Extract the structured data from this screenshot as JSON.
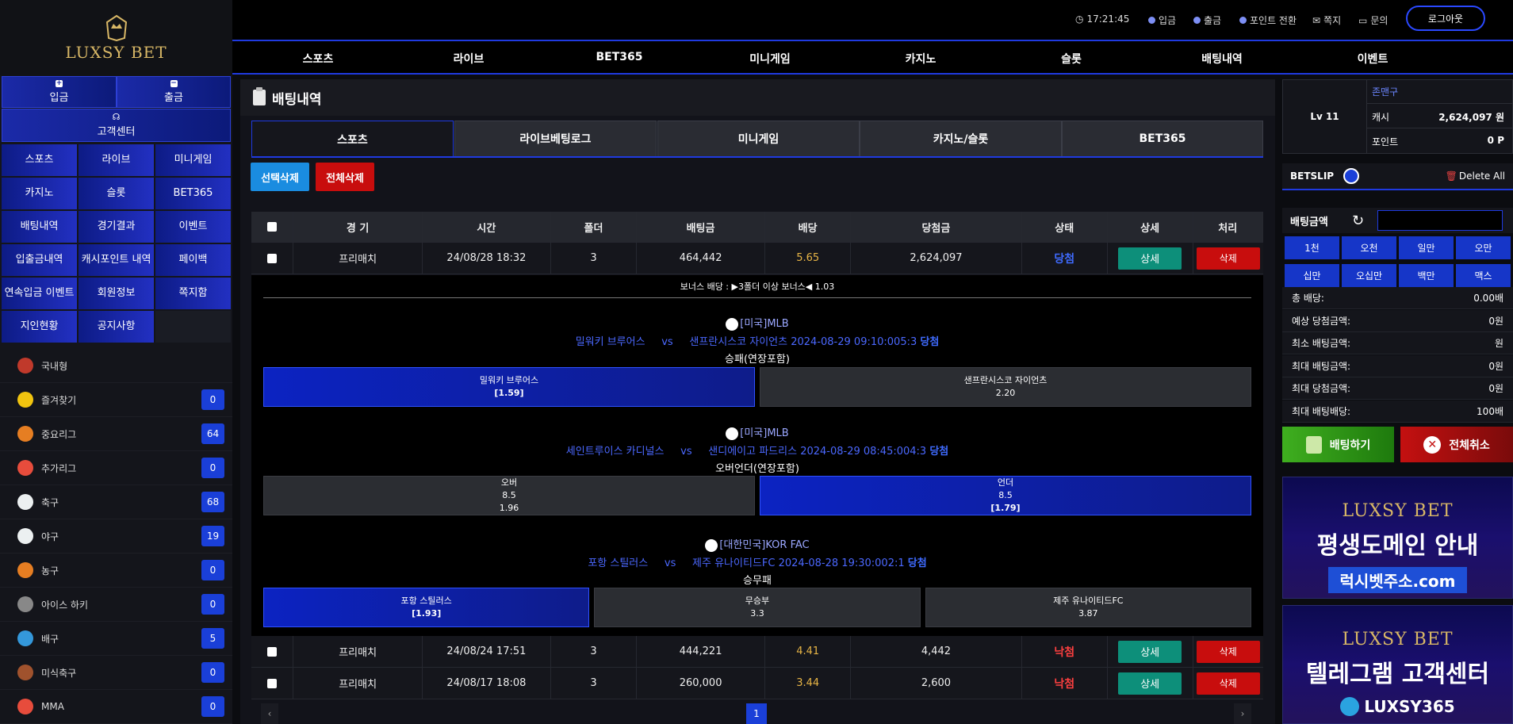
{
  "brand": {
    "name": "LUXSY BET"
  },
  "left_top": {
    "deposit": "입금",
    "withdraw": "출금",
    "support": "고객센터"
  },
  "menu": [
    "스포츠",
    "라이브",
    "미니게임",
    "카지노",
    "슬롯",
    "BET365",
    "배팅내역",
    "경기결과",
    "이벤트",
    "입출금내역",
    "캐시포인트 내역",
    "페이백",
    "연속입금 이벤트",
    "회원정보",
    "쪽지함",
    "지인현황",
    "공지사항"
  ],
  "sports": [
    {
      "name": "국내형",
      "count": "",
      "icon": "yin-yang-icon",
      "color": "#c0392b"
    },
    {
      "name": "즐겨찾기",
      "count": "0",
      "icon": "star-icon",
      "color": "#f1c40f"
    },
    {
      "name": "중요리그",
      "count": "64",
      "icon": "trophy-icon",
      "color": "#e67e22"
    },
    {
      "name": "추가리그",
      "count": "0",
      "icon": "medal-icon",
      "color": "#e74c3c"
    },
    {
      "name": "축구",
      "count": "68",
      "icon": "soccer-ball-icon",
      "color": "#ecf0f1"
    },
    {
      "name": "야구",
      "count": "19",
      "icon": "baseball-icon",
      "color": "#ecf0f1"
    },
    {
      "name": "농구",
      "count": "0",
      "icon": "basketball-icon",
      "color": "#e67e22"
    },
    {
      "name": "아이스 하키",
      "count": "0",
      "icon": "hockey-puck-icon",
      "color": "#888"
    },
    {
      "name": "배구",
      "count": "5",
      "icon": "volleyball-icon",
      "color": "#3498db"
    },
    {
      "name": "미식축구",
      "count": "0",
      "icon": "football-icon",
      "color": "#a0522d"
    },
    {
      "name": "MMA",
      "count": "0",
      "icon": "mma-glove-icon",
      "color": "#e74c3c"
    }
  ],
  "topbar": {
    "time": "17:21:45",
    "deposit": "입금",
    "withdraw": "출금",
    "point": "포인트 전환",
    "message": "쪽지",
    "inquiry": "문의",
    "logout": "로그아웃"
  },
  "nav": [
    "스포츠",
    "라이브",
    "BET365",
    "미니게임",
    "카지노",
    "슬롯",
    "배팅내역",
    "이벤트"
  ],
  "page": {
    "title": "배팅내역",
    "tabs": [
      "스포츠",
      "라이브베팅로그",
      "미니게임",
      "카지노/슬롯",
      "BET365"
    ],
    "select_delete": "선택삭제",
    "all_delete": "전체삭제"
  },
  "table": {
    "headers": [
      "경 기",
      "시간",
      "폴더",
      "배팅금",
      "배당",
      "당첨금",
      "상태",
      "상세",
      "처리"
    ],
    "rows": [
      {
        "type": "프리매치",
        "time": "24/08/28 18:32",
        "folder": "3",
        "bet": "464,442",
        "odds": "5.65",
        "win": "2,624,097",
        "status": "당첨",
        "detail": "상세",
        "action": "삭제"
      },
      {
        "type": "프리매치",
        "time": "24/08/24 17:51",
        "folder": "3",
        "bet": "444,221",
        "odds": "4.41",
        "win": "4,442",
        "status": "낙첨",
        "detail": "상세",
        "action": "삭제"
      },
      {
        "type": "프리매치",
        "time": "24/08/17 18:08",
        "folder": "3",
        "bet": "260,000",
        "odds": "3.44",
        "win": "2,600",
        "status": "낙첨",
        "detail": "상세",
        "action": "삭제"
      }
    ]
  },
  "detail": {
    "bonus": "보너스 배당 : ▶3폴더 이상 보너스◀ 1.03",
    "games": [
      {
        "league": "[미국]MLB",
        "home": "밀워키 브루어스",
        "vs": "vs",
        "away": "샌프란시스코 자이언츠",
        "time": "2024-08-29 09:10:00",
        "score": "5:3",
        "result": "당첨",
        "market": "승패(연장포함)",
        "options": [
          {
            "l1": "밀워키 브루어스",
            "l2": "",
            "l3": "[1.59]"
          },
          {
            "l1": "샌프란시스코 자이언츠",
            "l2": "",
            "l3": "2.20"
          }
        ]
      },
      {
        "league": "[미국]MLB",
        "home": "세인트루이스 카디널스",
        "vs": "vs",
        "away": "샌디에이고 파드리스",
        "time": "2024-08-29 08:45:00",
        "score": "4:3",
        "result": "당첨",
        "market": "오버언더(연장포함)",
        "options": [
          {
            "l1": "오버",
            "l2": "8.5",
            "l3": "1.96"
          },
          {
            "l1": "언더",
            "l2": "8.5",
            "l3": "[1.79]"
          }
        ]
      },
      {
        "league": "[대한민국]KOR FAC",
        "home": "포항 스틸러스",
        "vs": "vs",
        "away": "제주 유나이티드FC",
        "time": "2024-08-28 19:30:00",
        "score": "2:1",
        "result": "당첨",
        "market": "승무패",
        "options": [
          {
            "l1": "포항 스틸러스",
            "l2": "",
            "l3": "[1.93]"
          },
          {
            "l1": "무승부",
            "l2": "",
            "l3": "3.3"
          },
          {
            "l1": "제주 유나이티드FC",
            "l2": "",
            "l3": "3.87"
          }
        ]
      }
    ]
  },
  "pagination": {
    "current": "1"
  },
  "user": {
    "level": "Lv 11",
    "name": "존맨구",
    "cash_label": "캐시",
    "cash": "2,624,097 원",
    "point_label": "포인트",
    "point": "0 P"
  },
  "betslip": {
    "title": "BETSLIP",
    "delete_all": "Delete All",
    "amount_label": "배팅금액",
    "amount_value": "",
    "amounts": [
      "1천",
      "오천",
      "일만",
      "오만",
      "십만",
      "오십만",
      "백만",
      "맥스"
    ],
    "summary": [
      {
        "k": "총 배당:",
        "v": "0.00배"
      },
      {
        "k": "예상 당첨금액:",
        "v": "0원"
      },
      {
        "k": "최소 배팅금액:",
        "v": "원"
      },
      {
        "k": "최대 배팅금액:",
        "v": "0원"
      },
      {
        "k": "최대 당첨금액:",
        "v": "0원"
      },
      {
        "k": "최대 배팅배당:",
        "v": "100배"
      }
    ],
    "bet": "배팅하기",
    "cancel": "전체취소"
  },
  "banners": [
    {
      "logo": "LUXSY BET",
      "title": "평생도메인 안내",
      "sub": "럭시벳주소.com"
    },
    {
      "logo": "LUXSY BET",
      "title": "텔레그램 고객센터",
      "sub": "LUXSY365"
    }
  ],
  "colors": {
    "accent": "#1f3ae0",
    "win": "#3f6bff",
    "lose": "#ff4040",
    "odds": "#e8b546"
  }
}
